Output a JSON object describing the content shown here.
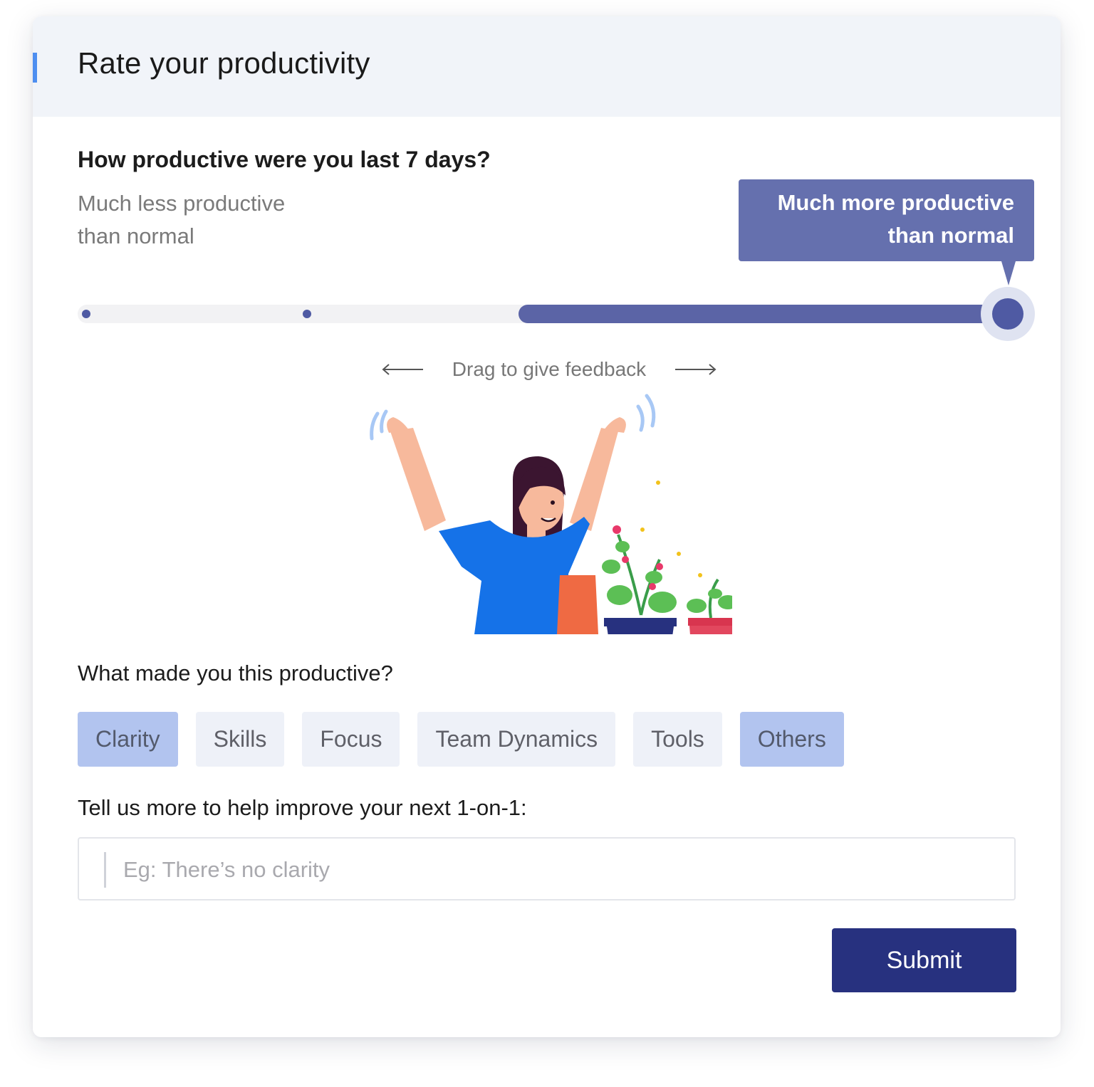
{
  "header": {
    "title": "Rate your productivity"
  },
  "rating": {
    "question": "How productive were you last 7 days?",
    "low_label_line1": "Much less productive",
    "low_label_line2": "than normal",
    "high_label_line1": "Much more productive",
    "high_label_line2": "than normal",
    "value": 5,
    "steps": 5,
    "hint": "Drag to give feedback",
    "accent_color": "#5b64a6"
  },
  "reasons": {
    "question": "What made you this productive?",
    "options": [
      {
        "label": "Clarity",
        "selected": true
      },
      {
        "label": "Skills",
        "selected": false
      },
      {
        "label": "Focus",
        "selected": false
      },
      {
        "label": "Team Dynamics",
        "selected": false
      },
      {
        "label": "Tools",
        "selected": false
      },
      {
        "label": "Others",
        "selected": true
      }
    ]
  },
  "feedback": {
    "question": "Tell us more to help improve your next 1-on-1:",
    "placeholder": "Eg: There’s no clarity",
    "value": ""
  },
  "actions": {
    "submit_label": "Submit",
    "submit_color": "#27317f"
  }
}
